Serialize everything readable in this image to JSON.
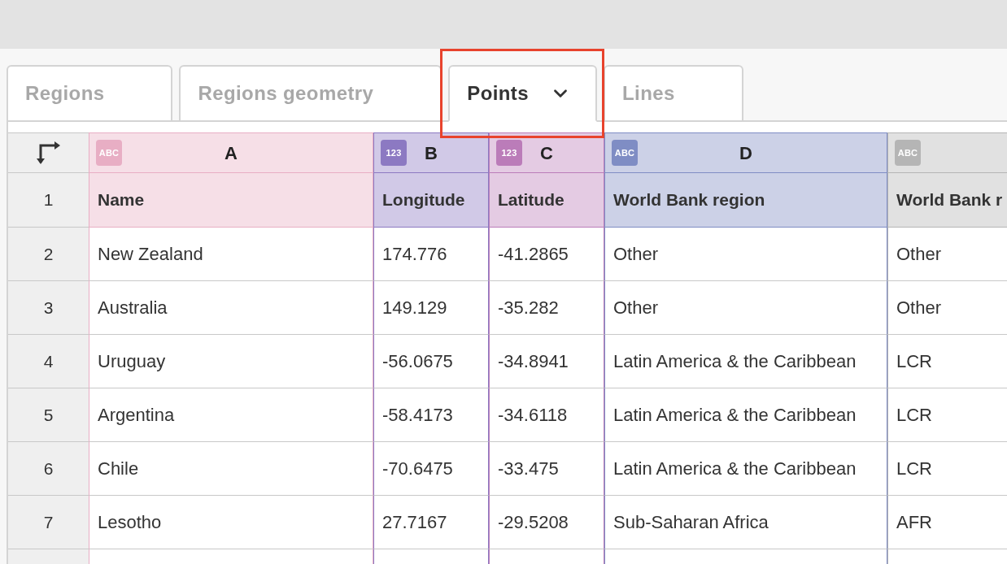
{
  "tabs": [
    {
      "label": "Regions",
      "selected": false
    },
    {
      "label": "Regions geometry",
      "selected": false
    },
    {
      "label": "Points",
      "selected": true
    },
    {
      "label": "Lines",
      "selected": false
    }
  ],
  "sheet": {
    "columns": [
      {
        "letter": "A",
        "badge": "ABC",
        "color": "#e8aec4"
      },
      {
        "letter": "B",
        "badge": "123",
        "color": "#8c79c2"
      },
      {
        "letter": "C",
        "badge": "123",
        "color": "#bb7cb9"
      },
      {
        "letter": "D",
        "badge": "ABC",
        "color": "#7f8dc4"
      },
      {
        "badge": "ABC",
        "color": "#b5b5b5"
      }
    ],
    "rows": [
      {
        "number": "1",
        "kind": "header",
        "cells": [
          "Name",
          "Longitude",
          "Latitude",
          "World Bank region",
          "World Bank r"
        ]
      },
      {
        "number": "2",
        "kind": "data",
        "cells": [
          "New Zealand",
          "174.776",
          "-41.2865",
          "Other",
          "Other"
        ]
      },
      {
        "number": "3",
        "kind": "data",
        "cells": [
          "Australia",
          "149.129",
          "-35.282",
          "Other",
          "Other"
        ]
      },
      {
        "number": "4",
        "kind": "data",
        "cells": [
          "Uruguay",
          "-56.0675",
          "-34.8941",
          "Latin America & the Caribbean",
          "LCR"
        ]
      },
      {
        "number": "5",
        "kind": "data",
        "cells": [
          "Argentina",
          "-58.4173",
          "-34.6118",
          "Latin America & the Caribbean",
          "LCR"
        ]
      },
      {
        "number": "6",
        "kind": "data",
        "cells": [
          "Chile",
          "-70.6475",
          "-33.475",
          "Latin America & the Caribbean",
          "LCR"
        ]
      },
      {
        "number": "7",
        "kind": "data",
        "cells": [
          "Lesotho",
          "27.7167",
          "-29.5208",
          "Sub-Saharan Africa",
          "AFR"
        ]
      }
    ]
  }
}
